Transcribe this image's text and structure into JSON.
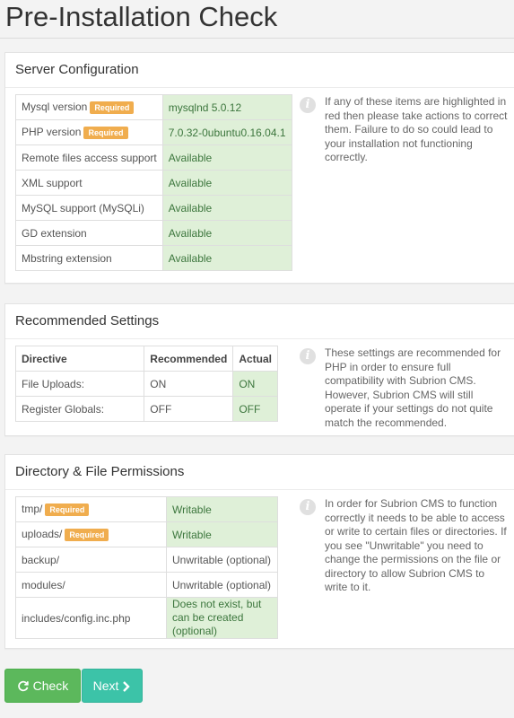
{
  "page": {
    "title": "Pre-Installation Check"
  },
  "server": {
    "heading": "Server Configuration",
    "rows": [
      {
        "label": "Mysql version",
        "badge": "Required",
        "value": "mysqlnd 5.0.12"
      },
      {
        "label": "PHP version",
        "badge": "Required",
        "value": "7.0.32-0ubuntu0.16.04.1"
      },
      {
        "label": "Remote files access support",
        "value": "Available"
      },
      {
        "label": "XML support",
        "value": "Available"
      },
      {
        "label": "MySQL support (MySQLi)",
        "value": "Available"
      },
      {
        "label": "GD extension",
        "value": "Available"
      },
      {
        "label": "Mbstring extension",
        "value": "Available"
      }
    ],
    "info": "If any of these items are highlighted in red then please take actions to correct them. Failure to do so could lead to your installation not functioning correctly."
  },
  "recommended": {
    "heading": "Recommended Settings",
    "columns": [
      "Directive",
      "Recommended",
      "Actual"
    ],
    "rows": [
      {
        "directive": "File Uploads:",
        "recommended": "ON",
        "actual": "ON"
      },
      {
        "directive": "Register Globals:",
        "recommended": "OFF",
        "actual": "OFF"
      }
    ],
    "info": "These settings are recommended for PHP in order to ensure full compatibility with Subrion CMS. However, Subrion CMS will still operate if your settings do not quite match the recommended."
  },
  "permissions": {
    "heading": "Directory & File Permissions",
    "rows": [
      {
        "path": "tmp/",
        "badge": "Required",
        "status": "Writable",
        "ok": true
      },
      {
        "path": "uploads/",
        "badge": "Required",
        "status": "Writable",
        "ok": true
      },
      {
        "path": "backup/",
        "status": "Unwritable (optional)",
        "ok": false
      },
      {
        "path": "modules/",
        "status": "Unwritable (optional)",
        "ok": false
      },
      {
        "path": "includes/config.inc.php",
        "status": "Does not exist, but can be created (optional)",
        "ok": true
      }
    ],
    "info": "In order for Subrion CMS to function correctly it needs to be able to access or write to certain files or directories. If you see \"Unwritable\" you need to change the permissions on the file or directory to allow Subrion CMS to write to it."
  },
  "buttons": {
    "check": "Check",
    "next": "Next"
  },
  "icons": {
    "info": "info-icon",
    "check": "refresh-icon",
    "next": "chevron-right-icon"
  },
  "colors": {
    "ok_bg": "#dff0d8",
    "ok_text": "#3c763d",
    "badge": "#f0ad4e",
    "check_btn": "#5cb85c",
    "next_btn": "#3cc3a8"
  }
}
